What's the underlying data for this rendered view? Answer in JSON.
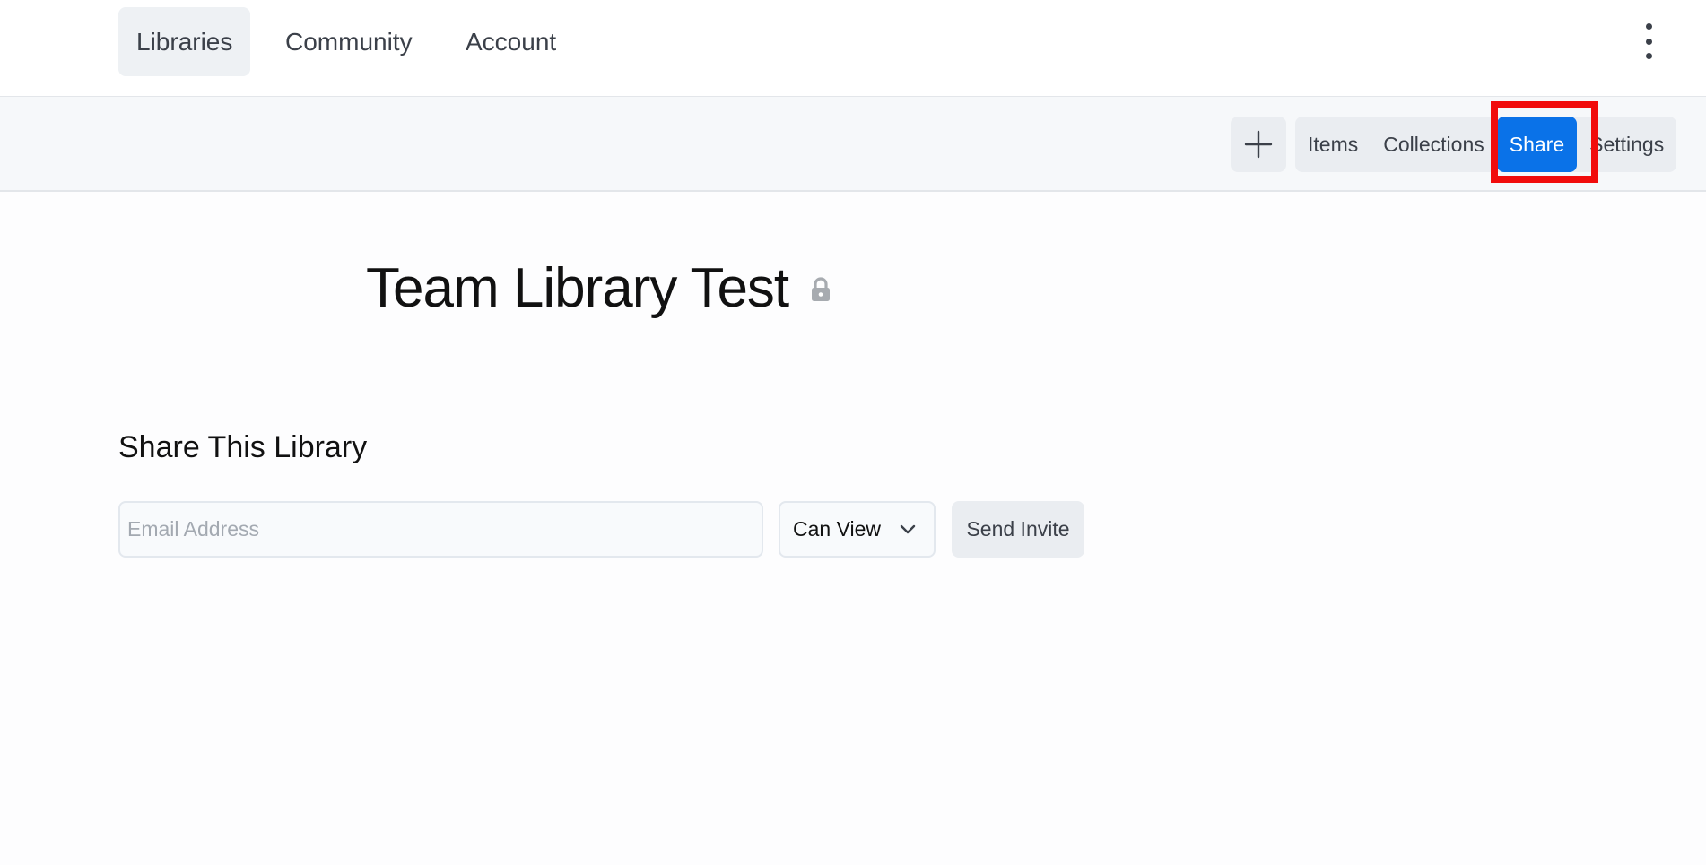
{
  "nav": {
    "tabs": [
      {
        "label": "Libraries",
        "active": true
      },
      {
        "label": "Community",
        "active": false
      },
      {
        "label": "Account",
        "active": false
      }
    ],
    "more_icon": "kebab-vertical-icon"
  },
  "toolbar": {
    "add_icon": "plus-icon",
    "items": [
      {
        "label": "Items",
        "active": false
      },
      {
        "label": "Collections",
        "active": false
      },
      {
        "label": "Share",
        "active": true
      },
      {
        "label": "Settings",
        "active": false
      }
    ],
    "highlight_color": "#f10c0c",
    "accent_color": "#0a72e8"
  },
  "library": {
    "title": "Team Library Test",
    "privacy_icon": "lock-icon"
  },
  "share": {
    "heading": "Share This Library",
    "email_placeholder": "Email Address",
    "email_value": "",
    "permission_selected": "Can View",
    "send_label": "Send Invite"
  }
}
